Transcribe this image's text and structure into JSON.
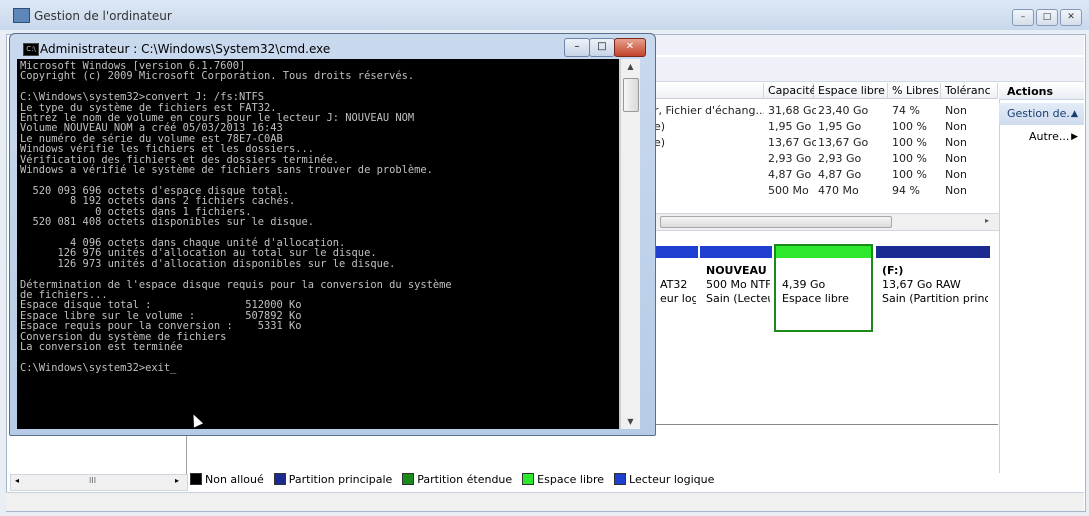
{
  "window": {
    "title": "Gestion de l'ordinateur",
    "btn_min": "–",
    "btn_max": "□",
    "btn_close": "✕"
  },
  "volume_table": {
    "headers": [
      "Capacité",
      "Espace libre",
      "% Libres",
      "Toléranc"
    ],
    "rows": [
      {
        "name": "r, Fichier d'échang...",
        "capacity": "31,68 Go",
        "free": "23,40 Go",
        "pct": "74 %",
        "tol": "Non"
      },
      {
        "name": "e)",
        "capacity": "1,95 Go",
        "free": "1,95 Go",
        "pct": "100 %",
        "tol": "Non"
      },
      {
        "name": "e)",
        "capacity": "13,67 Go",
        "free": "13,67 Go",
        "pct": "100 %",
        "tol": "Non"
      },
      {
        "name": "",
        "capacity": "2,93 Go",
        "free": "2,93 Go",
        "pct": "100 %",
        "tol": "Non"
      },
      {
        "name": "",
        "capacity": "4,87 Go",
        "free": "4,87 Go",
        "pct": "100 %",
        "tol": "Non"
      },
      {
        "name": "",
        "capacity": "500 Mo",
        "free": "470 Mo",
        "pct": "94 %",
        "tol": "Non"
      }
    ]
  },
  "disk_map": {
    "partitions": [
      {
        "line1": "",
        "line2": "AT32",
        "line3": "eur logi",
        "bar_color": "#1f3fd0"
      },
      {
        "line1": "NOUVEAU I",
        "line2": "500 Mo NTF",
        "line3": "Sain (Lecteu",
        "bar_color": "#1f3fd0"
      },
      {
        "line1": "",
        "line2": "4,39 Go",
        "line3": "Espace libre",
        "bar_color": "#2ee82e"
      },
      {
        "line1": "(F:)",
        "line2": "13,67 Go RAW",
        "line3": "Sain (Partition princi",
        "bar_color": "#1a2a90"
      }
    ]
  },
  "legend": [
    {
      "label": "Non alloué",
      "color": "#000000"
    },
    {
      "label": "Partition principale",
      "color": "#1a2a90"
    },
    {
      "label": "Partition étendue",
      "color": "#1a8a1a"
    },
    {
      "label": "Espace libre",
      "color": "#2ee82e"
    },
    {
      "label": "Lecteur logique",
      "color": "#1f3fd0"
    }
  ],
  "actions": {
    "header": "Actions",
    "section": "Gestion de...",
    "item": "Autre..."
  },
  "left_scroll": {
    "thumb": "III"
  },
  "cmd": {
    "title": "Administrateur : C:\\Windows\\System32\\cmd.exe",
    "icon": "C:\\",
    "output": "Microsoft Windows [version 6.1.7600]\nCopyright (c) 2009 Microsoft Corporation. Tous droits réservés.\n\nC:\\Windows\\system32>convert J: /fs:NTFS\nLe type du système de fichiers est FAT32.\nEntrez le nom de volume en cours pour le lecteur J: NOUVEAU NOM\nVolume NOUVEAU NOM a créé 05/03/2013 16:43\nLe numéro de série du volume est 78E7-C0AB\nWindows vérifie les fichiers et les dossiers...\nVérification des fichiers et des dossiers terminée.\nWindows a vérifié le système de fichiers sans trouver de problème.\n\n  520 093 696 octets d'espace disque total.\n        8 192 octets dans 2 fichiers cachés.\n            0 octets dans 1 fichiers.\n  520 081 408 octets disponibles sur le disque.\n\n        4 096 octets dans chaque unité d'allocation.\n      126 976 unités d'allocation au total sur le disque.\n      126 973 unités d'allocation disponibles sur le disque.\n\nDétermination de l'espace disque requis pour la conversion du système\nde fichiers...\nEspace disque total :               512000 Ko\nEspace libre sur le volume :        507892 Ko\nEspace requis pour la conversion :    5331 Ko\nConversion du système de fichiers\nLa conversion est terminée\n\nC:\\Windows\\system32>exit_"
  }
}
